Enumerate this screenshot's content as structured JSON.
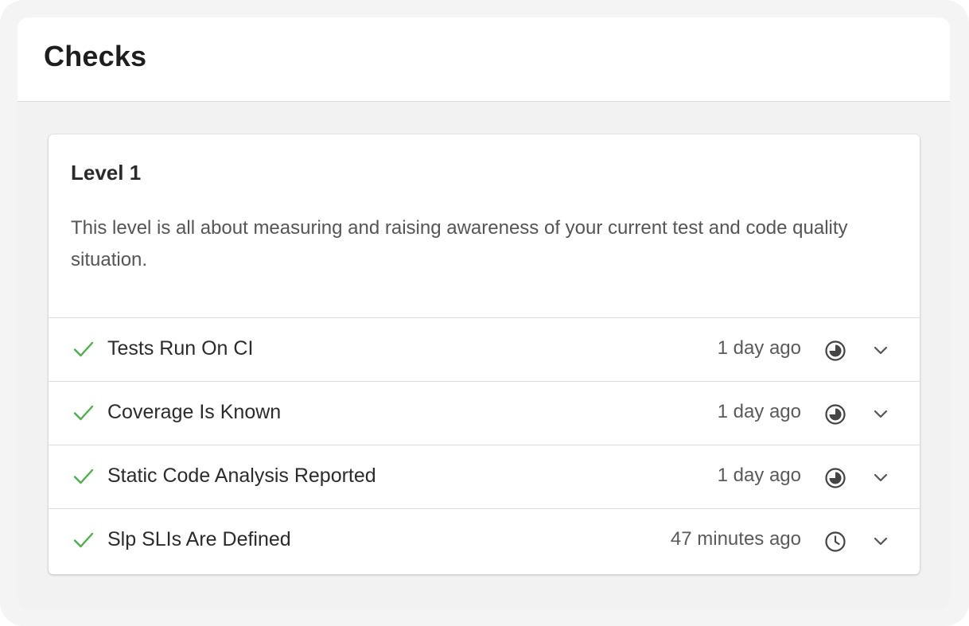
{
  "panel": {
    "title": "Checks"
  },
  "level": {
    "title": "Level 1",
    "description": "This level is all about measuring and raising awareness of your current test and code quality situation."
  },
  "checks": [
    {
      "label": "Tests Run On CI",
      "time": "1 day ago",
      "status_icon": "half-circle-icon",
      "result_icon": "checkmark-icon"
    },
    {
      "label": "Coverage Is Known",
      "time": "1 day ago",
      "status_icon": "half-circle-icon",
      "result_icon": "checkmark-icon"
    },
    {
      "label": "Static Code Analysis Reported",
      "time": "1 day ago",
      "status_icon": "half-circle-icon",
      "result_icon": "checkmark-icon"
    },
    {
      "label": "Slp SLIs Are Defined",
      "time": "47 minutes ago",
      "status_icon": "clock-icon",
      "result_icon": "checkmark-icon"
    }
  ],
  "colors": {
    "check_green": "#4caf50",
    "icon_gray": "#444444"
  }
}
